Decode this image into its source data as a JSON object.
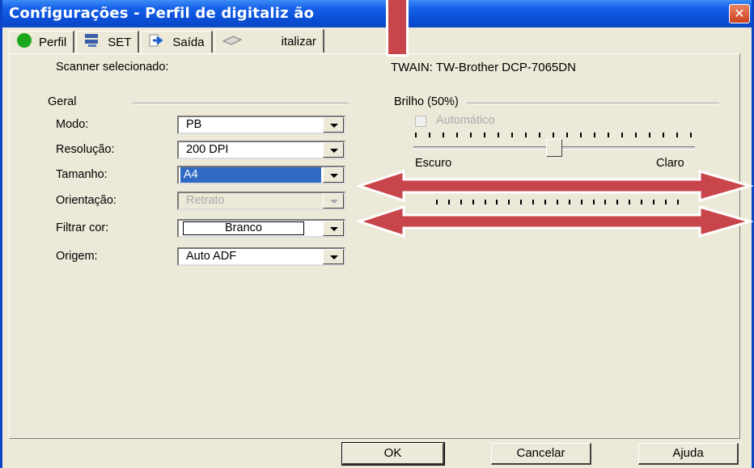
{
  "window": {
    "title": "Configurações - Perfil de digitaliz   ão",
    "close_glyph": "✕"
  },
  "tabs": [
    {
      "label": "Perfil",
      "icon": "green-circle-icon"
    },
    {
      "label": "SET",
      "icon": "network-icon"
    },
    {
      "label": "Saída",
      "icon": "arrow-right-icon"
    },
    {
      "label": "Digitalizar",
      "icon": "scanner-icon"
    }
  ],
  "tab_visible_text": "italizar",
  "scanner": {
    "label": "Scanner selecionado:",
    "value": "TWAIN: TW-Brother DCP-7065DN"
  },
  "geral": {
    "title": "Geral",
    "fields": [
      {
        "label": "Modo:",
        "value": "PB"
      },
      {
        "label": "Resolução:",
        "value": "200 DPI"
      },
      {
        "label": "Tamanho:",
        "value": "A4"
      },
      {
        "label": "Orientação:",
        "value": "Retrato"
      },
      {
        "label": "Filtrar cor:",
        "value": "Branco"
      },
      {
        "label": "Origem:",
        "value": "Auto ADF"
      }
    ]
  },
  "brilho": {
    "title": "Brilho (50%)",
    "auto_label": "Automático",
    "left_label": "Escuro",
    "right_label": "Claro",
    "level": 0.5
  },
  "buttons": {
    "ok": "OK",
    "cancel": "Cancelar",
    "help": "Ajuda"
  },
  "colors": {
    "title_bar": "#0b4fd6",
    "annotation": "#c8454b",
    "selection": "#316ac5"
  }
}
